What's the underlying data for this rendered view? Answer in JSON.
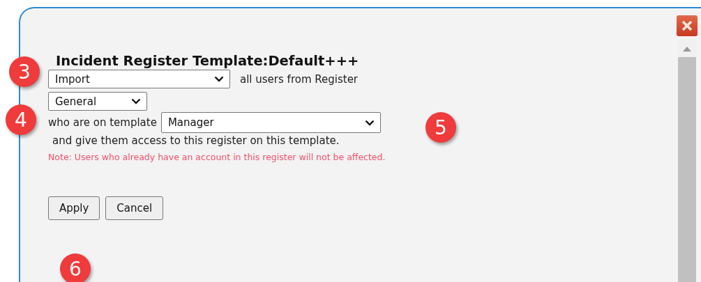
{
  "dialog": {
    "title": "Incident Register Template:Default+++",
    "action_select": {
      "value": "Import"
    },
    "action_text": "all users from Register",
    "register_select": {
      "value": "General"
    },
    "template_text": "who are on template",
    "template_select": {
      "value": "Manager"
    },
    "access_text": "and give them access to this register on this template.",
    "note": "Note: Users who already have an account in this register will not be affected.",
    "buttons": [
      "Apply",
      "Cancel"
    ]
  },
  "callouts": [
    "3",
    "4",
    "5",
    "6"
  ]
}
